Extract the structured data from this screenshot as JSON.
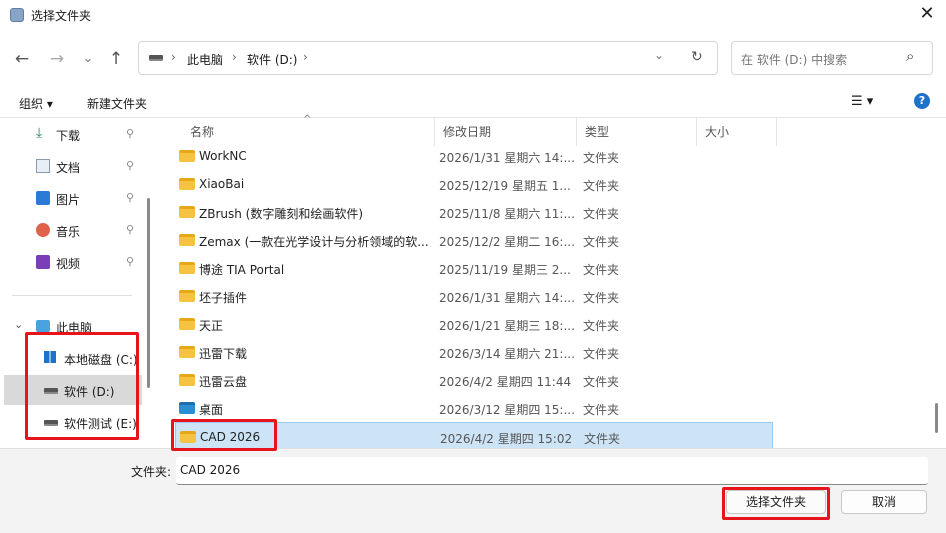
{
  "window": {
    "title": "选择文件夹",
    "close_glyph": "✕"
  },
  "nav": {
    "back_glyph": "←",
    "forward_glyph": "→",
    "recent_glyph": "⌄",
    "up_glyph": "↑",
    "breadcrumb": [
      "此电脑",
      "软件 (D:)"
    ],
    "separator": "›",
    "dropdown_glyph": "⌄",
    "refresh_glyph": "↻",
    "search_placeholder": "在 软件 (D:) 中搜索",
    "search_glyph": "⌕"
  },
  "cmd": {
    "organize": "组织 ▾",
    "new_folder": "新建文件夹",
    "view_glyph": "☰ ▾",
    "help_glyph": "?"
  },
  "sidebar": {
    "quick": [
      {
        "label": "下载",
        "icon": "download-icon",
        "pin": "📌"
      },
      {
        "label": "文档",
        "icon": "document-icon",
        "pin": "📌"
      },
      {
        "label": "图片",
        "icon": "picture-icon",
        "pin": "📌"
      },
      {
        "label": "音乐",
        "icon": "music-icon",
        "pin": "📌"
      },
      {
        "label": "视频",
        "icon": "video-icon",
        "pin": "📌"
      }
    ],
    "this_pc": "此电脑",
    "drives": [
      "本地磁盘 (C:)",
      "软件 (D:)",
      "软件测试 (E:)"
    ]
  },
  "columns": {
    "name": "名称",
    "date": "修改日期",
    "type": "类型",
    "size": "大小"
  },
  "files": [
    {
      "name": "WorkNC",
      "date": "2026/1/31 星期六 14:...",
      "type": "文件夹"
    },
    {
      "name": "XiaoBai",
      "date": "2025/12/19 星期五 1...",
      "type": "文件夹"
    },
    {
      "name": "ZBrush (数字雕刻和绘画软件)",
      "date": "2025/11/8 星期六 11:...",
      "type": "文件夹"
    },
    {
      "name": "Zemax (一款在光学设计与分析领域的软...",
      "date": "2025/12/2 星期二 16:...",
      "type": "文件夹"
    },
    {
      "name": "博途 TIA Portal",
      "date": "2025/11/19 星期三 2...",
      "type": "文件夹"
    },
    {
      "name": "坯子插件",
      "date": "2026/1/31 星期六 14:...",
      "type": "文件夹"
    },
    {
      "name": "天正",
      "date": "2026/1/21 星期三 18:...",
      "type": "文件夹"
    },
    {
      "name": "迅雷下载",
      "date": "2026/3/14 星期六 21:...",
      "type": "文件夹"
    },
    {
      "name": "迅雷云盘",
      "date": "2026/4/2 星期四 11:44",
      "type": "文件夹"
    },
    {
      "name": "桌面",
      "date": "2026/3/12 星期四 15:...",
      "type": "文件夹"
    },
    {
      "name": "CAD 2026",
      "date": "2026/4/2 星期四 15:02",
      "type": "文件夹"
    }
  ],
  "footer": {
    "folder_label": "文件夹:",
    "folder_value": "CAD 2026",
    "select_button": "选择文件夹",
    "cancel_button": "取消"
  },
  "colors": {
    "highlight": "#e8141c",
    "selection": "#cde4f7",
    "folder": "#f5c242"
  }
}
